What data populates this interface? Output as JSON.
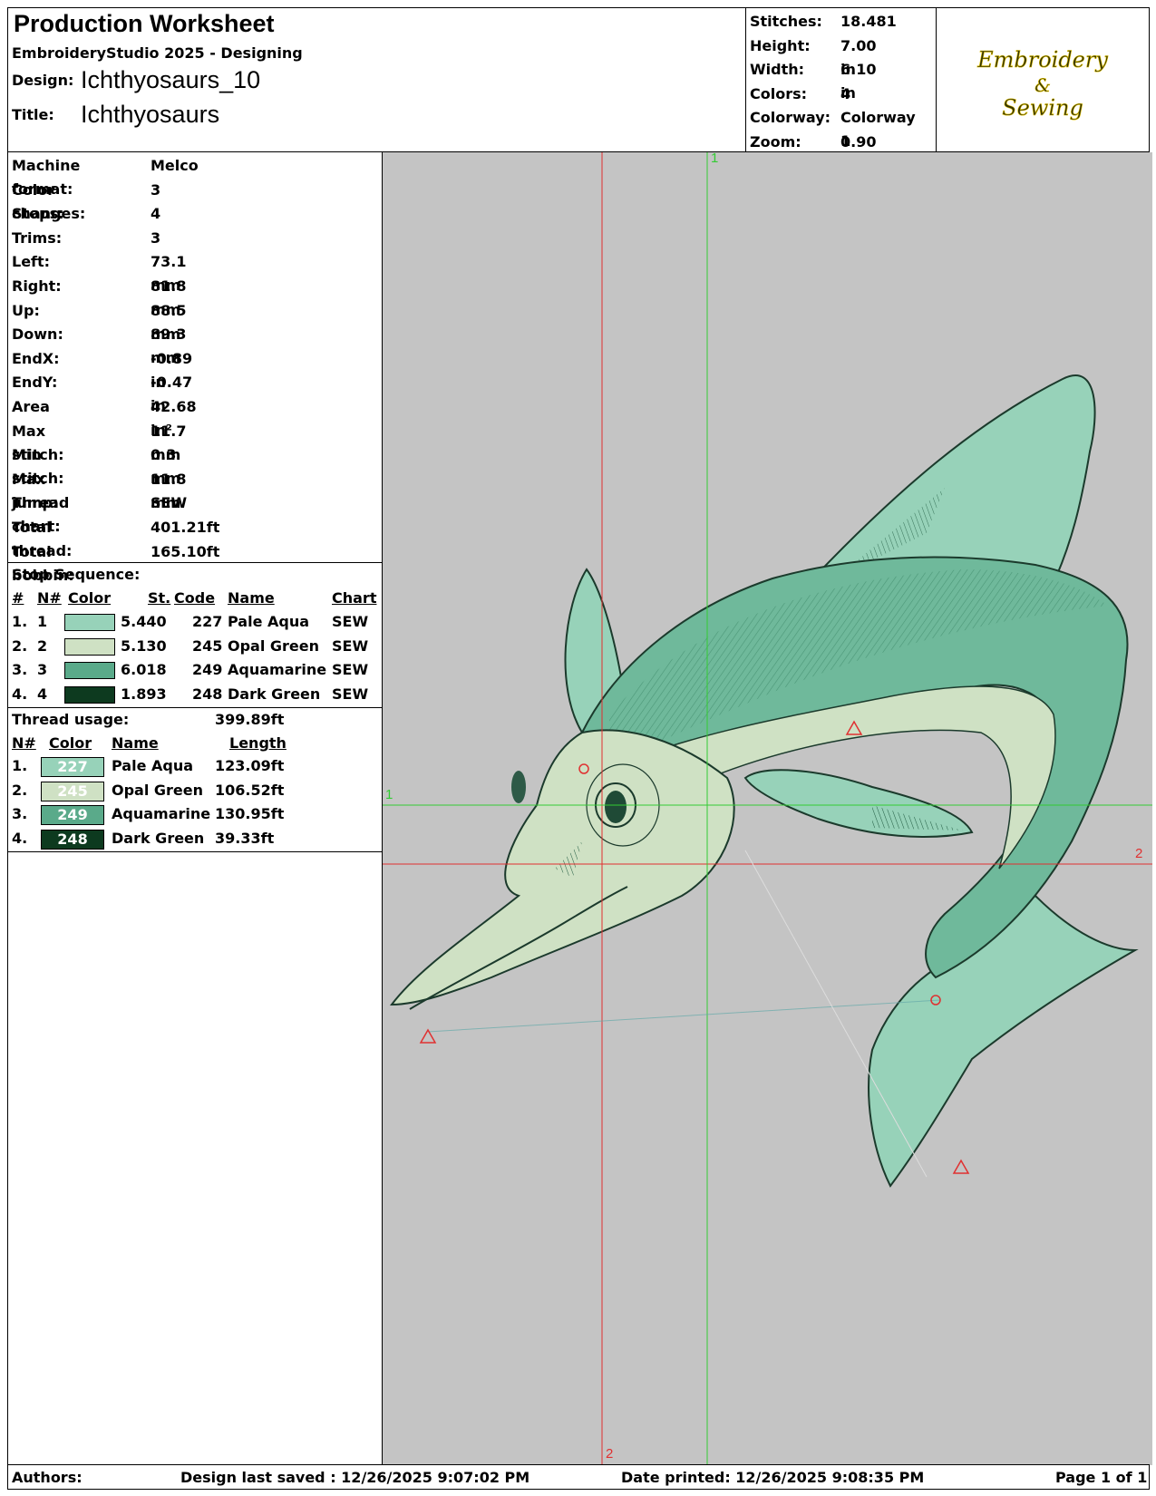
{
  "header": {
    "title": "Production Worksheet",
    "software": "EmbroideryStudio 2025 - Designing",
    "design_label": "Design:",
    "design_value": "Ichthyosaurs_10",
    "title_label": "Title:",
    "title_value": "Ichthyosaurs"
  },
  "summary": [
    {
      "label": "Stitches:",
      "value": "18.481"
    },
    {
      "label": "Height:",
      "value": "7.00 in"
    },
    {
      "label": "Width:",
      "value": "6.10 in"
    },
    {
      "label": "Colors:",
      "value": "4"
    },
    {
      "label": "Colorway:",
      "value": "Colorway 1"
    },
    {
      "label": "Zoom:",
      "value": "0.90"
    }
  ],
  "logo": {
    "line1": "Embroidery",
    "line2": "&",
    "line3": "Sewing"
  },
  "details": [
    {
      "label": "Machine format:",
      "value": "Melco"
    },
    {
      "label": "Color changes:",
      "value": "3"
    },
    {
      "label": "Stops:",
      "value": "4"
    },
    {
      "label": "Trims:",
      "value": "3"
    },
    {
      "label": "Left:",
      "value": "73.1 mm"
    },
    {
      "label": "Right:",
      "value": "81.8 mm"
    },
    {
      "label": "Up:",
      "value": "88.5 mm"
    },
    {
      "label": "Down:",
      "value": "89.3 mm"
    },
    {
      "label": "EndX:",
      "value": "-0.89 in"
    },
    {
      "label": "EndY:",
      "value": "-0.47 in"
    },
    {
      "label": "Area",
      "value": " 42.68 in²"
    },
    {
      "label": "Max stitch:",
      "value": "11.7 mm"
    },
    {
      "label": "Min stitch:",
      "value": "0.3 mm"
    },
    {
      "label": "Max jump:",
      "value": "11.8 mm"
    },
    {
      "label": "Thread chart:",
      "value": "SEW"
    },
    {
      "label": "Total thread:",
      "value": "401.21ft"
    },
    {
      "label": "Total bobbin:",
      "value": "165.10ft"
    }
  ],
  "stop_sequence": {
    "title": "Stop Sequence:",
    "headers": [
      "#",
      "N#",
      "Color",
      "St.",
      "Code",
      "Name",
      "Chart"
    ],
    "rows": [
      {
        "num": "1.",
        "n": "1",
        "color": "#97d2b9",
        "st": "5.440",
        "code": "227",
        "name": "Pale Aqua",
        "chart": "SEW"
      },
      {
        "num": "2.",
        "n": "2",
        "color": "#cfe1c4",
        "st": "5.130",
        "code": "245",
        "name": "Opal Green",
        "chart": "SEW"
      },
      {
        "num": "3.",
        "n": "3",
        "color": "#5aaa8a",
        "st": "6.018",
        "code": "249",
        "name": "Aquamarine",
        "chart": "SEW"
      },
      {
        "num": "4.",
        "n": "4",
        "color": "#0d3a1f",
        "st": "1.893",
        "code": "248",
        "name": "Dark Green",
        "chart": "SEW"
      }
    ]
  },
  "thread_usage": {
    "title": "Thread usage:",
    "total": "399.89ft",
    "headers": [
      "N#",
      "Color",
      "Name",
      "Length"
    ],
    "rows": [
      {
        "n": "1.",
        "code": "227",
        "color": "#97d2b9",
        "name": "Pale Aqua",
        "length": "123.09ft"
      },
      {
        "n": "2.",
        "code": "245",
        "color": "#cfe1c4",
        "name": "Opal Green",
        "length": "106.52ft"
      },
      {
        "n": "3.",
        "code": "249",
        "color": "#5aaa8a",
        "name": "Aquamarine",
        "length": "130.95ft"
      },
      {
        "n": "4.",
        "code": "248",
        "color": "#0d3a1f",
        "name": "Dark Green",
        "length": "39.33ft"
      }
    ]
  },
  "canvas": {
    "axis_h_green": "1",
    "axis_v_green": "1",
    "axis_h_red": "2",
    "axis_v_red": "2"
  },
  "footer": {
    "authors": "Authors:",
    "saved": "Design last saved : 12/26/2025 9:07:02 PM",
    "printed": "Date printed: 12/26/2025 9:08:35 PM",
    "page": "Page 1 of 1"
  }
}
